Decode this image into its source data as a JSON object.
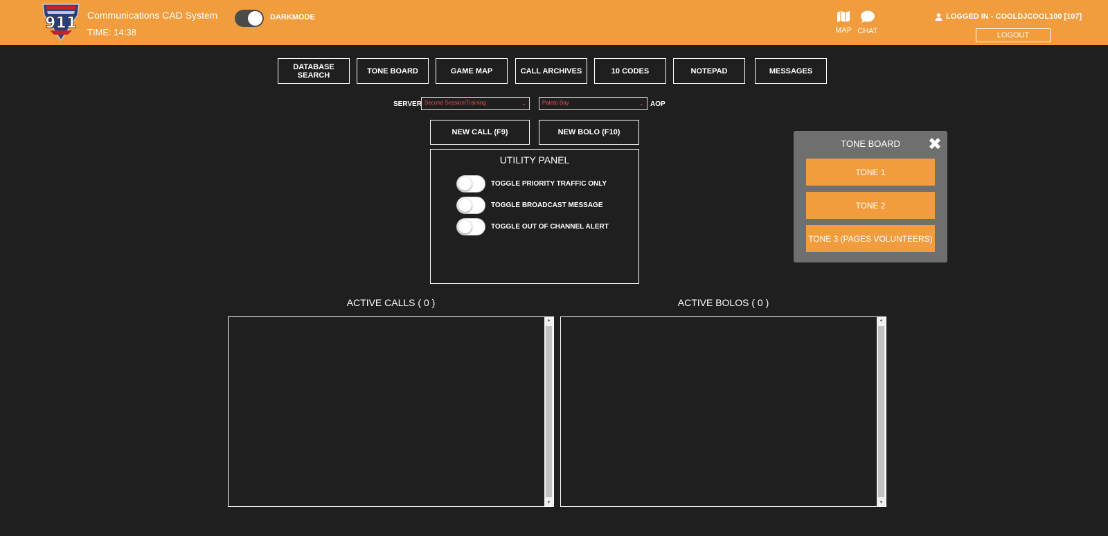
{
  "header": {
    "title": "Communications CAD System",
    "time": "TIME: 14:38",
    "darkmode_label": "DARKMODE",
    "map_label": "MAP",
    "chat_label": "CHAT",
    "user_label": "LOGGED IN - COOLDJCOOL100 [107]",
    "logout_label": "LOGOUT",
    "accent_color": "#f19d3e"
  },
  "toolbar": {
    "buttons": [
      "DATABASE SEARCH",
      "TONE BOARD",
      "GAME MAP",
      "CALL ARCHIVES",
      "10 CODES",
      "NOTEPAD",
      "MESSAGES"
    ]
  },
  "selectors": {
    "server_label": "SERVER",
    "server_value": "Second Session/Training",
    "aop_value": "Paleto Bay",
    "aop_label": "AOP"
  },
  "actions": {
    "new_call": "NEW CALL (F9)",
    "new_bolo": "NEW BOLO (F10)"
  },
  "utility": {
    "title": "UTILITY PANEL",
    "toggles": [
      "TOGGLE PRIORITY TRAFFIC ONLY",
      "TOGGLE BROADCAST MESSAGE",
      "TOGGLE OUT OF CHANNEL ALERT"
    ]
  },
  "lists": {
    "calls_title": "ACTIVE CALLS ( 0 )",
    "bolos_title": "ACTIVE BOLOS ( 0 )"
  },
  "toneboard": {
    "title": "TONE BOARD",
    "tones": [
      "TONE 1",
      "TONE 2",
      "TONE 3 (PAGES VOLUNTEERS)"
    ]
  }
}
